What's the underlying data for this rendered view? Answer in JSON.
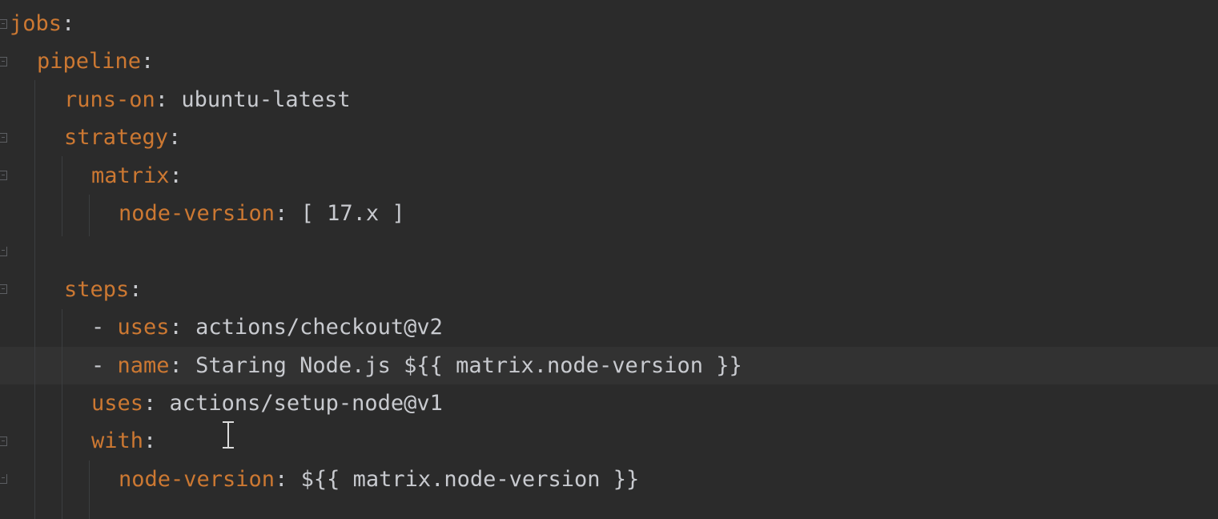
{
  "editor": {
    "language": "yaml",
    "current_line_index": 9,
    "lines": [
      {
        "indent": 0,
        "dash": "",
        "key": "jobs",
        "colon": ":",
        "value": ""
      },
      {
        "indent": 1,
        "dash": "",
        "key": "pipeline",
        "colon": ":",
        "value": ""
      },
      {
        "indent": 2,
        "dash": "",
        "key": "runs-on",
        "colon": ": ",
        "value": "ubuntu-latest"
      },
      {
        "indent": 2,
        "dash": "",
        "key": "strategy",
        "colon": ":",
        "value": ""
      },
      {
        "indent": 3,
        "dash": "",
        "key": "matrix",
        "colon": ":",
        "value": ""
      },
      {
        "indent": 4,
        "dash": "",
        "key": "node-version",
        "colon": ": ",
        "value": "[ 17.x ]"
      },
      {
        "indent": 0,
        "dash": "",
        "key": "",
        "colon": "",
        "value": ""
      },
      {
        "indent": 2,
        "dash": "",
        "key": "steps",
        "colon": ":",
        "value": ""
      },
      {
        "indent": 3,
        "dash": "- ",
        "key": "uses",
        "colon": ": ",
        "value": "actions/checkout@v2"
      },
      {
        "indent": 3,
        "dash": "- ",
        "key": "name",
        "colon": ": ",
        "value": "Staring Node.js ${{ matrix.node-version }}"
      },
      {
        "indent": 3,
        "dash": "",
        "key": "uses",
        "colon": ": ",
        "value": "actions/setup-node@v1"
      },
      {
        "indent": 3,
        "dash": "",
        "key": "with",
        "colon": ":",
        "value": ""
      },
      {
        "indent": 4,
        "dash": "",
        "key": "node-version",
        "colon": ": ",
        "value": "${{ matrix.node-version }}"
      }
    ]
  },
  "colors": {
    "background": "#2b2b2b",
    "key": "#cc7832",
    "text": "#c8cacf",
    "current_line": "#323232",
    "indent_guide": "#3c3e40"
  },
  "icons": {
    "fold_marker": "fold-marker-icon",
    "text_cursor": "text-cursor-icon"
  }
}
